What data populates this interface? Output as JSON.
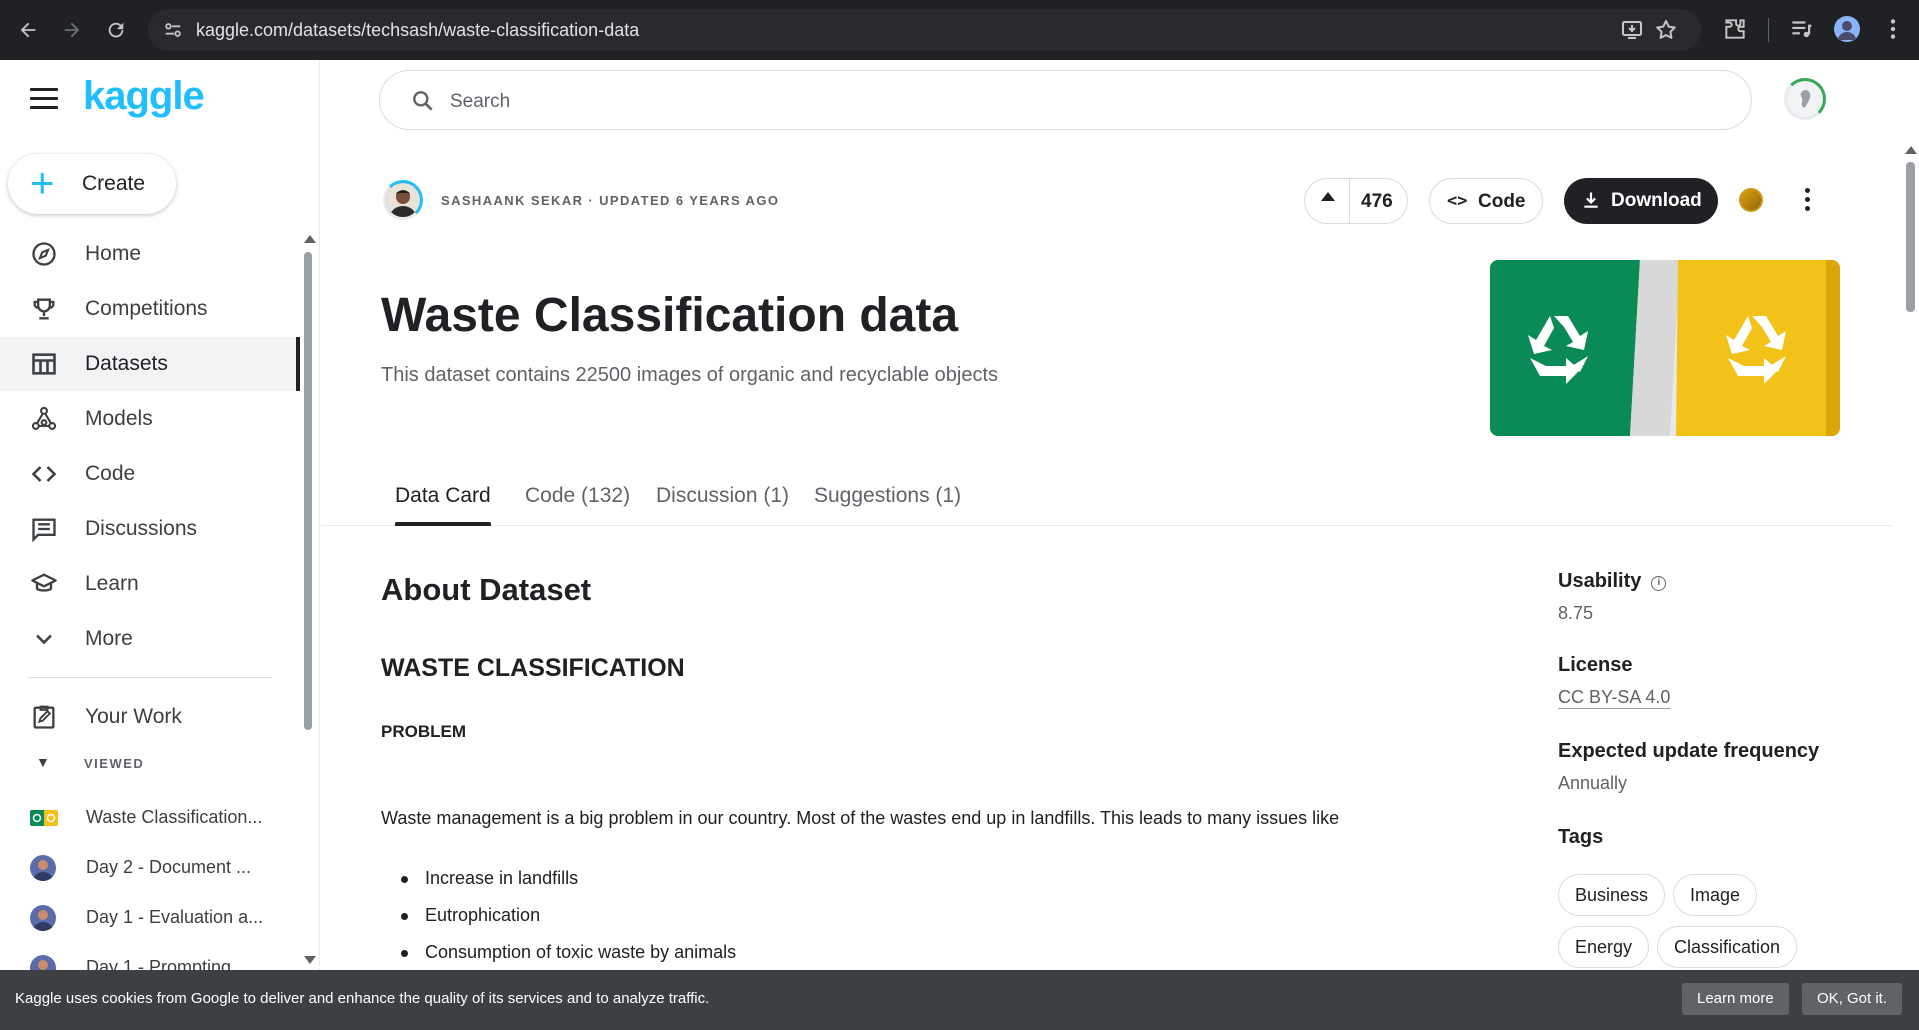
{
  "browser": {
    "url": "kaggle.com/datasets/techsash/waste-classification-data",
    "icons": [
      "back-arrow-icon",
      "forward-arrow-icon",
      "reload-icon",
      "site-settings-icon",
      "install-icon",
      "bookmark-star-icon",
      "extensions-icon",
      "media-icon",
      "profile-icon",
      "kebab-menu-icon"
    ]
  },
  "sidebar": {
    "logo": "kaggle",
    "create_label": "Create",
    "items": [
      {
        "label": "Home",
        "icon": "compass-icon"
      },
      {
        "label": "Competitions",
        "icon": "trophy-icon"
      },
      {
        "label": "Datasets",
        "icon": "table-icon",
        "active": true
      },
      {
        "label": "Models",
        "icon": "models-icon"
      },
      {
        "label": "Code",
        "icon": "code-icon"
      },
      {
        "label": "Discussions",
        "icon": "discussion-icon"
      },
      {
        "label": "Learn",
        "icon": "graduation-cap-icon"
      },
      {
        "label": "More",
        "icon": "chevron-down-icon"
      }
    ],
    "your_work": "Your Work",
    "viewed_label": "VIEWED",
    "viewed": [
      {
        "label": "Waste Classification..."
      },
      {
        "label": "Day 2 - Document ..."
      },
      {
        "label": "Day 1 - Evaluation a..."
      },
      {
        "label": "Day 1 - Prompting"
      }
    ]
  },
  "search": {
    "placeholder": "Search"
  },
  "dataset": {
    "owner_line": "SASHAANK SEKAR · UPDATED 6 YEARS AGO",
    "votes": "476",
    "code_label": "Code",
    "download_label": "Download",
    "title": "Waste Classification data",
    "subtitle": "This dataset contains 22500 images of organic and recyclable objects"
  },
  "tabs": [
    {
      "label": "Data Card",
      "active": true
    },
    {
      "label": "Code (132)"
    },
    {
      "label": "Discussion (1)"
    },
    {
      "label": "Suggestions (1)"
    }
  ],
  "content": {
    "about": "About Dataset",
    "heading": "WASTE CLASSIFICATION",
    "subheading": "PROBLEM",
    "paragraph": "Waste management is a big problem in our country. Most of the wastes end up in landfills. This leads to many issues like",
    "bullets": [
      "Increase in landfills",
      "Eutrophication",
      "Consumption of toxic waste by animals"
    ]
  },
  "meta": {
    "usability_label": "Usability",
    "usability_value": "8.75",
    "license_label": "License",
    "license_value": "CC BY-SA 4.0",
    "frequency_label": "Expected update frequency",
    "frequency_value": "Annually",
    "tags_label": "Tags",
    "tags": [
      "Business",
      "Image",
      "Energy",
      "Classification"
    ]
  },
  "cookie": {
    "message": "Kaggle uses cookies from Google to deliver and enhance the quality of its services and to analyze traffic.",
    "learn_more": "Learn more",
    "ok": "OK, Got it."
  },
  "colors": {
    "brand": "#20beff",
    "hero_green": "#0a8a57",
    "hero_yellow": "#f2c218"
  }
}
